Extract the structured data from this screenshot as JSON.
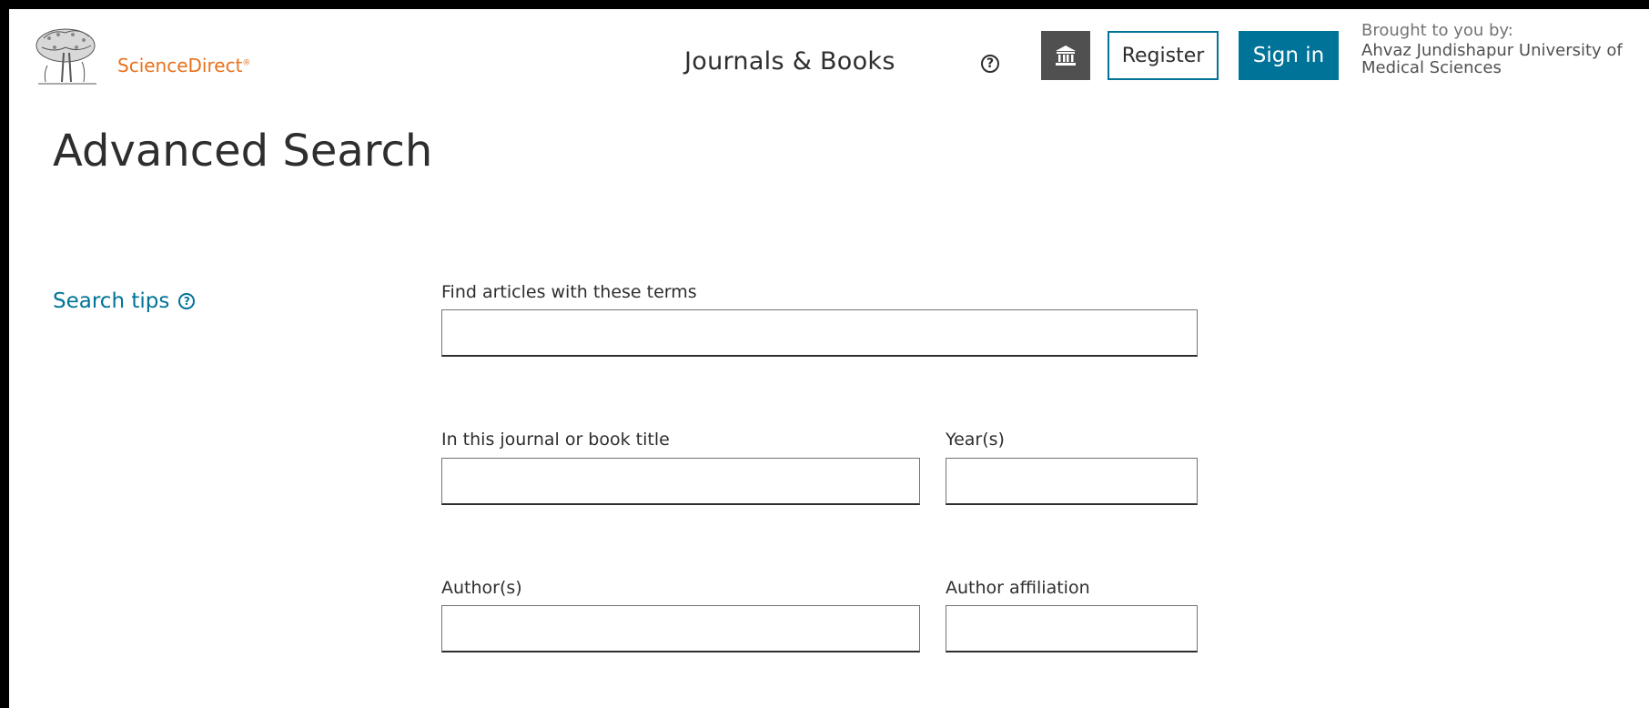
{
  "header": {
    "brand": "ScienceDirect",
    "brand_mark": "®",
    "nav_journals": "Journals & Books",
    "help_glyph": "?",
    "register_label": "Register",
    "signin_label": "Sign in",
    "brought_label": "Brought to you by:",
    "brought_org": "Ahvaz Jundishapur University of Medical Sciences"
  },
  "main": {
    "title": "Advanced Search",
    "search_tips": "Search tips",
    "help_glyph": "?",
    "fields": {
      "terms": {
        "label": "Find articles with these terms",
        "value": ""
      },
      "journal": {
        "label": "In this journal or book title",
        "value": ""
      },
      "years": {
        "label": "Year(s)",
        "value": ""
      },
      "authors": {
        "label": "Author(s)",
        "value": ""
      },
      "affiliation": {
        "label": "Author affiliation",
        "value": ""
      }
    }
  },
  "colors": {
    "brand_orange": "#e9711c",
    "accent_blue": "#007398",
    "institution_grey": "#505050"
  },
  "icons": [
    "elsevier-tree-logo",
    "help-icon",
    "institution-icon"
  ]
}
